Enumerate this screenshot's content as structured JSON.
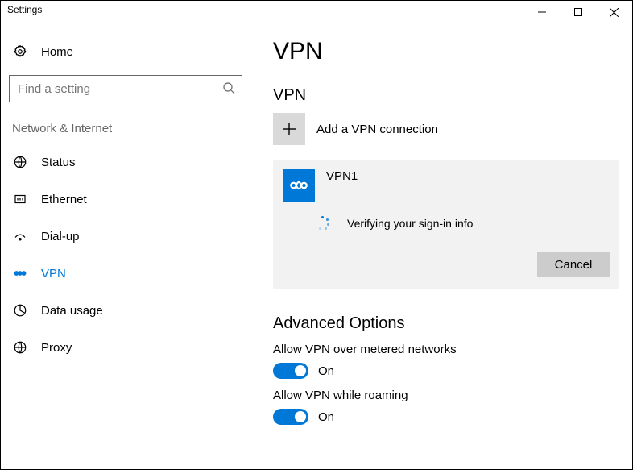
{
  "window": {
    "title": "Settings"
  },
  "sidebar": {
    "home_label": "Home",
    "search_placeholder": "Find a setting",
    "section_label": "Network & Internet",
    "items": [
      {
        "label": "Status",
        "icon": "status-icon"
      },
      {
        "label": "Ethernet",
        "icon": "ethernet-icon"
      },
      {
        "label": "Dial-up",
        "icon": "dialup-icon"
      },
      {
        "label": "VPN",
        "icon": "vpn-icon",
        "selected": true
      },
      {
        "label": "Data usage",
        "icon": "data-usage-icon"
      },
      {
        "label": "Proxy",
        "icon": "proxy-icon"
      }
    ]
  },
  "content": {
    "page_title": "VPN",
    "group_title": "VPN",
    "add_label": "Add a VPN connection",
    "vpn": {
      "name": "VPN1",
      "status": "Verifying your sign-in info",
      "cancel_label": "Cancel"
    },
    "advanced_title": "Advanced Options",
    "opts": [
      {
        "label": "Allow VPN over metered networks",
        "state": "On"
      },
      {
        "label": "Allow VPN while roaming",
        "state": "On"
      }
    ]
  }
}
